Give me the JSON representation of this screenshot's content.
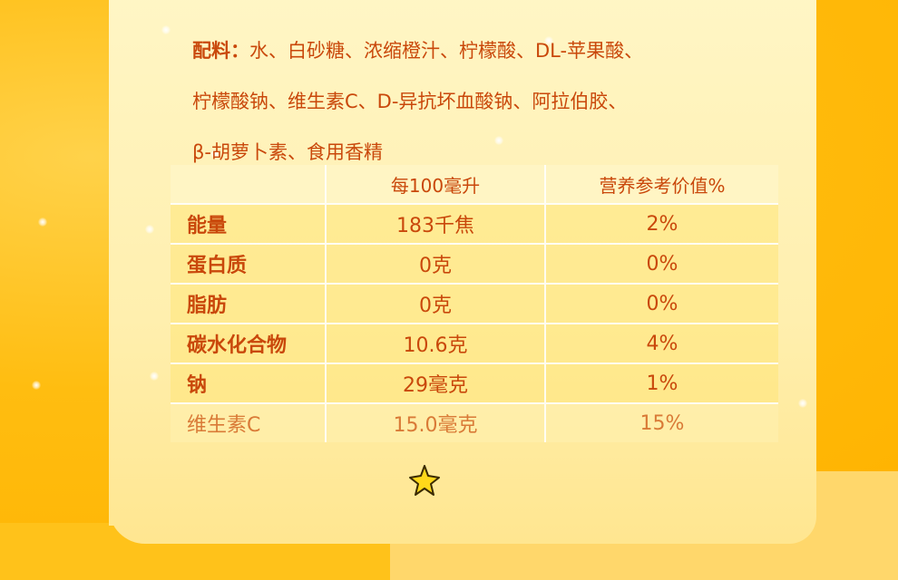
{
  "ingredients": {
    "label": "配料：",
    "lines": [
      "水、白砂糖、浓缩橙汁、柠檬酸、DL-苹果酸、",
      "柠檬酸钠、维生素C、D-异抗坏血酸钠、阿拉伯胶、",
      "β-胡萝卜素、食用香精"
    ]
  },
  "table": {
    "header": [
      "",
      "每100毫升",
      "营养参考价值%"
    ],
    "rows": [
      [
        "能量",
        "183千焦",
        "2%"
      ],
      [
        "蛋白质",
        "0克",
        "0%"
      ],
      [
        "脂肪",
        "0克",
        "0%"
      ],
      [
        "碳水化合物",
        "10.6克",
        "4%"
      ],
      [
        "钠",
        "29毫克",
        "1%"
      ],
      [
        "维生素C",
        "15.0毫克",
        "15%"
      ]
    ]
  },
  "colors": {
    "text": "#c9480b",
    "background": "#ffc21a",
    "panel": "#fff3bd"
  },
  "icons": [
    "star-icon"
  ]
}
